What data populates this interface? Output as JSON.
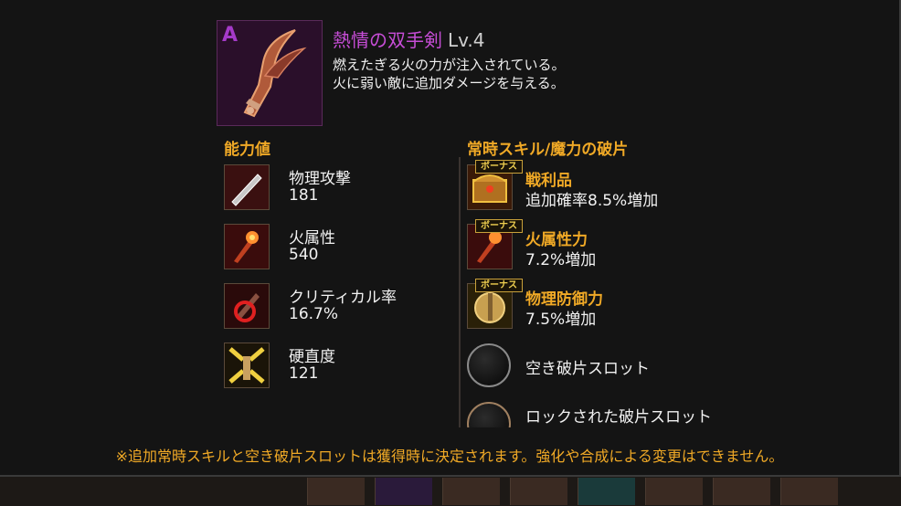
{
  "item": {
    "grade": "A",
    "name": "熱情の双手剣",
    "level": "Lv.4",
    "desc_line1": "燃えたぎる火の力が注入されている。",
    "desc_line2": "火に弱い敵に追加ダメージを与える。"
  },
  "stats": {
    "title": "能力値",
    "items": [
      {
        "name": "物理攻撃",
        "value": "181",
        "icon": "blade-icon"
      },
      {
        "name": "火属性",
        "value": "540",
        "icon": "fire-icon"
      },
      {
        "name": "クリティカル率",
        "value": "16.7%",
        "icon": "critical-icon"
      },
      {
        "name": "硬直度",
        "value": "121",
        "icon": "stagger-icon"
      }
    ]
  },
  "skills": {
    "title": "常時スキル/魔力の破片",
    "bonus_label": "ボーナス",
    "items": [
      {
        "name": "戦利品",
        "value": "追加確率8.5%増加",
        "icon": "treasure-chest-icon"
      },
      {
        "name": "火属性力",
        "value": "7.2%増加",
        "icon": "fire-icon"
      },
      {
        "name": "物理防御力",
        "value": "7.5%増加",
        "icon": "shield-icon"
      }
    ],
    "empty_slot": "空き破片スロット",
    "locked_slot": "ロックされた破片スロット"
  },
  "notice": "※追加常時スキルと空き破片スロットは獲得時に決定されます。強化や合成による変更はできません。",
  "colors": {
    "accent": "#f0a926",
    "item_name": "#c64dd6",
    "grade": "#a53ac9"
  }
}
